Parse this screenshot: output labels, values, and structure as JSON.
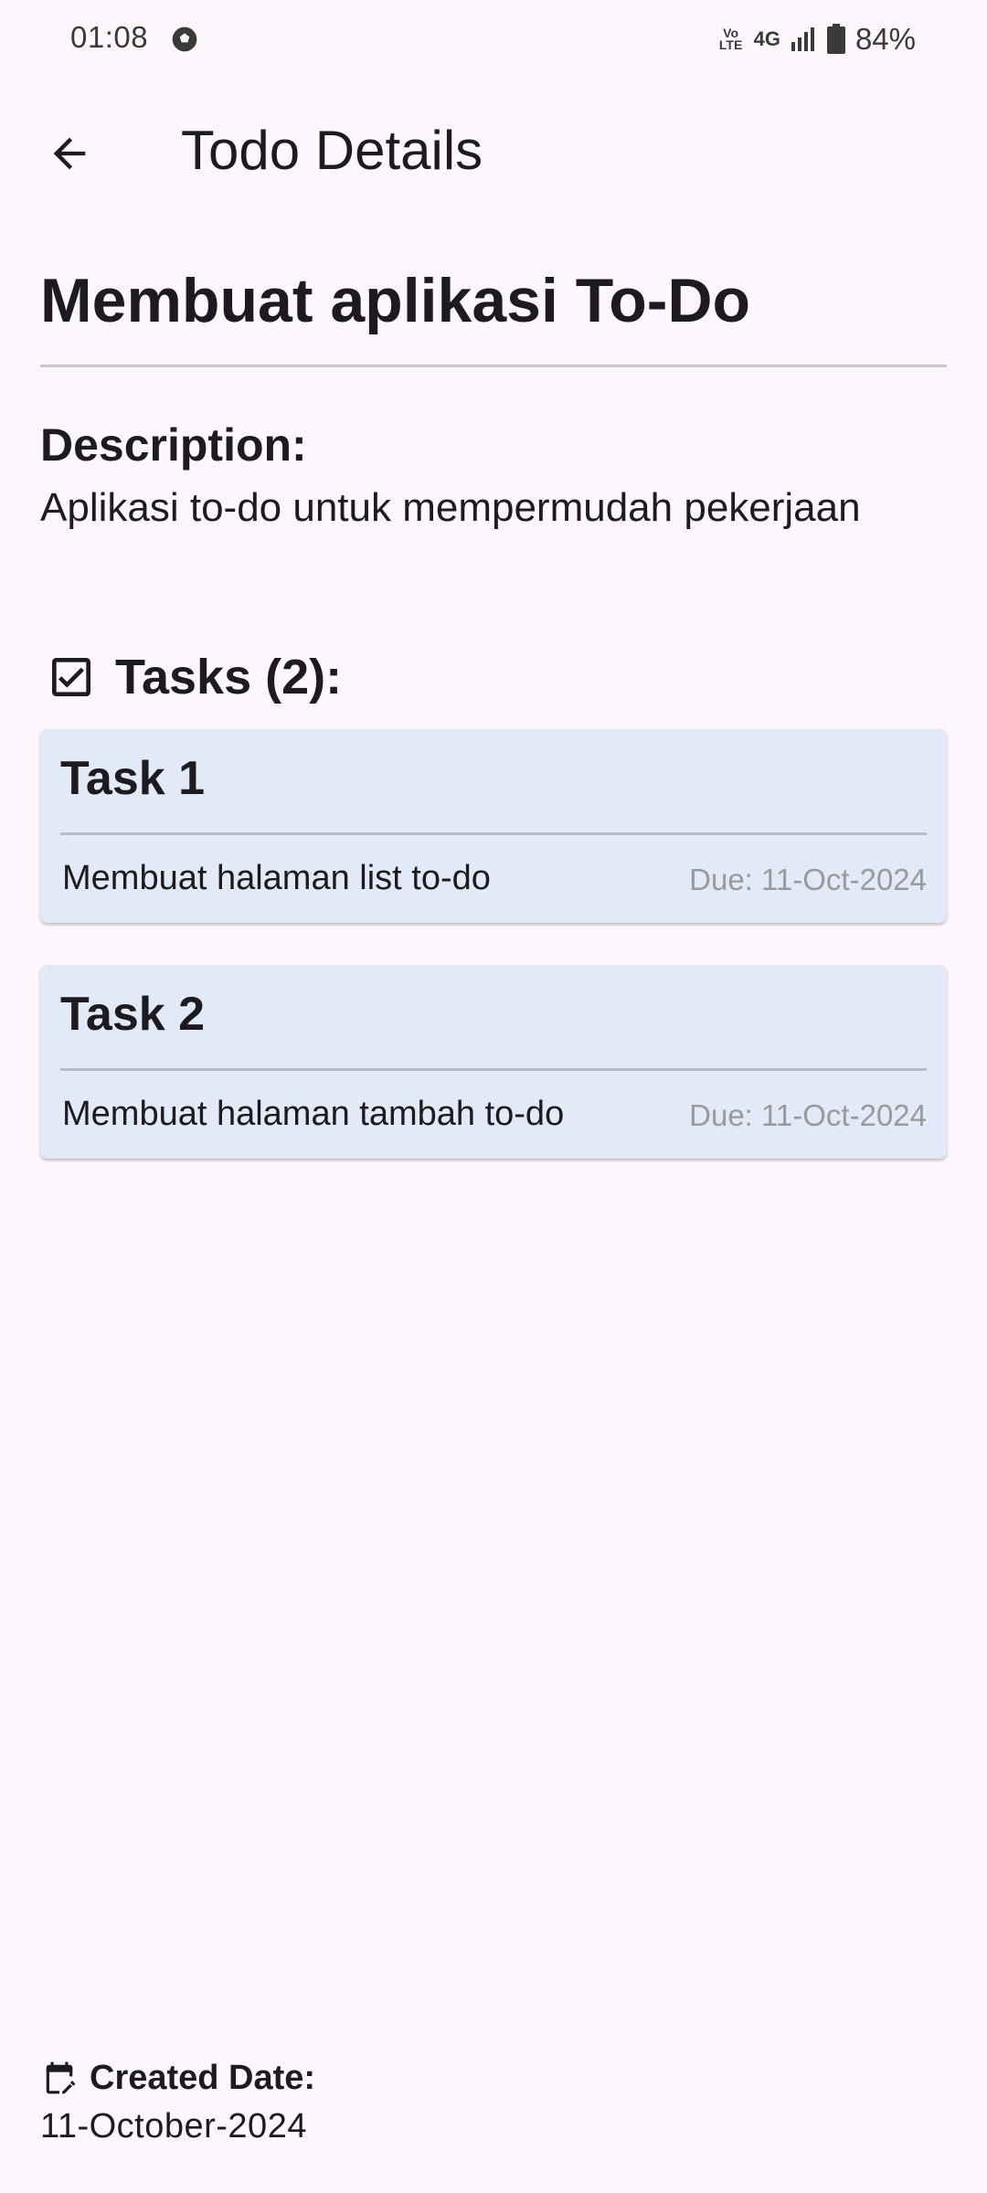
{
  "status_bar": {
    "time": "01:08",
    "network_volte": "Vo\nLTE",
    "network_type": "4G",
    "battery": "84%"
  },
  "app_bar": {
    "title": "Todo Details"
  },
  "todo": {
    "title": "Membuat aplikasi To-Do",
    "description_label": "Description:",
    "description": "Aplikasi to-do untuk mempermudah pekerjaan",
    "tasks_label": "Tasks (2):",
    "tasks": [
      {
        "name": "Task 1",
        "description": "Membuat halaman list to-do",
        "due": "Due: 11-Oct-2024"
      },
      {
        "name": "Task 2",
        "description": "Membuat halaman tambah to-do",
        "due": "Due: 11-Oct-2024"
      }
    ],
    "created_label": "Created Date:",
    "created_date": "11-October-2024"
  },
  "colors": {
    "background": "#FDF7FD",
    "card": "#E2E9F7",
    "text": "#1D1B20",
    "muted": "#9A9A9A"
  },
  "icons": {
    "back": "arrow-back-icon",
    "tasks": "checkbox-icon",
    "created": "calendar-edit-icon",
    "status_app": "soccer-ball-icon",
    "signal": "signal-icon",
    "battery": "battery-icon"
  }
}
